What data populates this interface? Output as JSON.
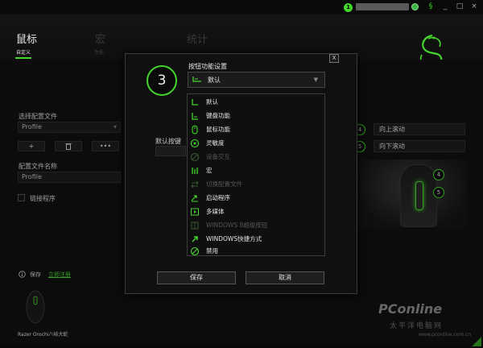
{
  "topbar": {
    "notification_count": "1",
    "window_buttons": [
      "_",
      "□",
      "×"
    ]
  },
  "header": {
    "tabs": [
      {
        "label": "鼠标",
        "active": true
      },
      {
        "label": "宏",
        "active": false
      },
      {
        "label": "统计",
        "active": false
      }
    ],
    "subtabs": [
      {
        "label": "自定义",
        "active": true
      },
      {
        "label": "性能",
        "active": false
      },
      {
        "label": "",
        "active": false
      },
      {
        "label": "",
        "active": false
      },
      {
        "label": "",
        "active": false
      },
      {
        "label": "",
        "active": false
      }
    ]
  },
  "left_panel": {
    "profile_section_label": "选择配置文件",
    "profile_value": "Profile",
    "add_button": "+",
    "delete_button": "🗑",
    "more_button": "•••",
    "profile_name_label": "配置文件名称",
    "profile_name_value": "Profile",
    "link_program_label": "链接程序",
    "protect_label": "保存",
    "register_link": "立即注册",
    "device_name": "Razer Orochi八岐大蛇"
  },
  "right_panel": {
    "assignments": [
      {
        "number": "4",
        "action": "向上滚动"
      },
      {
        "number": "5",
        "action": "向下滚动"
      }
    ],
    "callouts": [
      "4",
      "5"
    ]
  },
  "modal": {
    "button_number": "3",
    "title": "按钮功能设置",
    "selected_value": "默认",
    "body_label": "默认按键",
    "save_button": "保存",
    "cancel_button": "取消",
    "close_button": "X"
  },
  "dropdown": {
    "items": [
      {
        "label": "默认",
        "icon": "default-icon",
        "disabled": false
      },
      {
        "label": "键盘功能",
        "icon": "keyboard-icon",
        "disabled": false
      },
      {
        "label": "鼠标功能",
        "icon": "mouse-icon",
        "disabled": false
      },
      {
        "label": "灵敏度",
        "icon": "sensitivity-icon",
        "disabled": false
      },
      {
        "label": "设备交互",
        "icon": "device-interaction-icon",
        "disabled": true
      },
      {
        "label": "宏",
        "icon": "macro-icon",
        "disabled": false
      },
      {
        "label": "切换配置文件",
        "icon": "switch-profile-icon",
        "disabled": true
      },
      {
        "label": "启动程序",
        "icon": "launch-program-icon",
        "disabled": false
      },
      {
        "label": "多媒体",
        "icon": "multimedia-icon",
        "disabled": false
      },
      {
        "label": "WINDOWS 8超级按钮",
        "icon": "windows8-charms-icon",
        "disabled": true
      },
      {
        "label": "WINDOWS快捷方式",
        "icon": "windows-shortcut-icon",
        "disabled": false
      },
      {
        "label": "禁用",
        "icon": "disable-icon",
        "disabled": false
      }
    ]
  },
  "watermark": {
    "brand": "PConline",
    "sub": "太平洋电脑网",
    "url": "www.pconline.com.cn"
  },
  "colors": {
    "accent": "#44d62c",
    "background": "#0d0d0d",
    "panel": "#1c1c1c"
  }
}
